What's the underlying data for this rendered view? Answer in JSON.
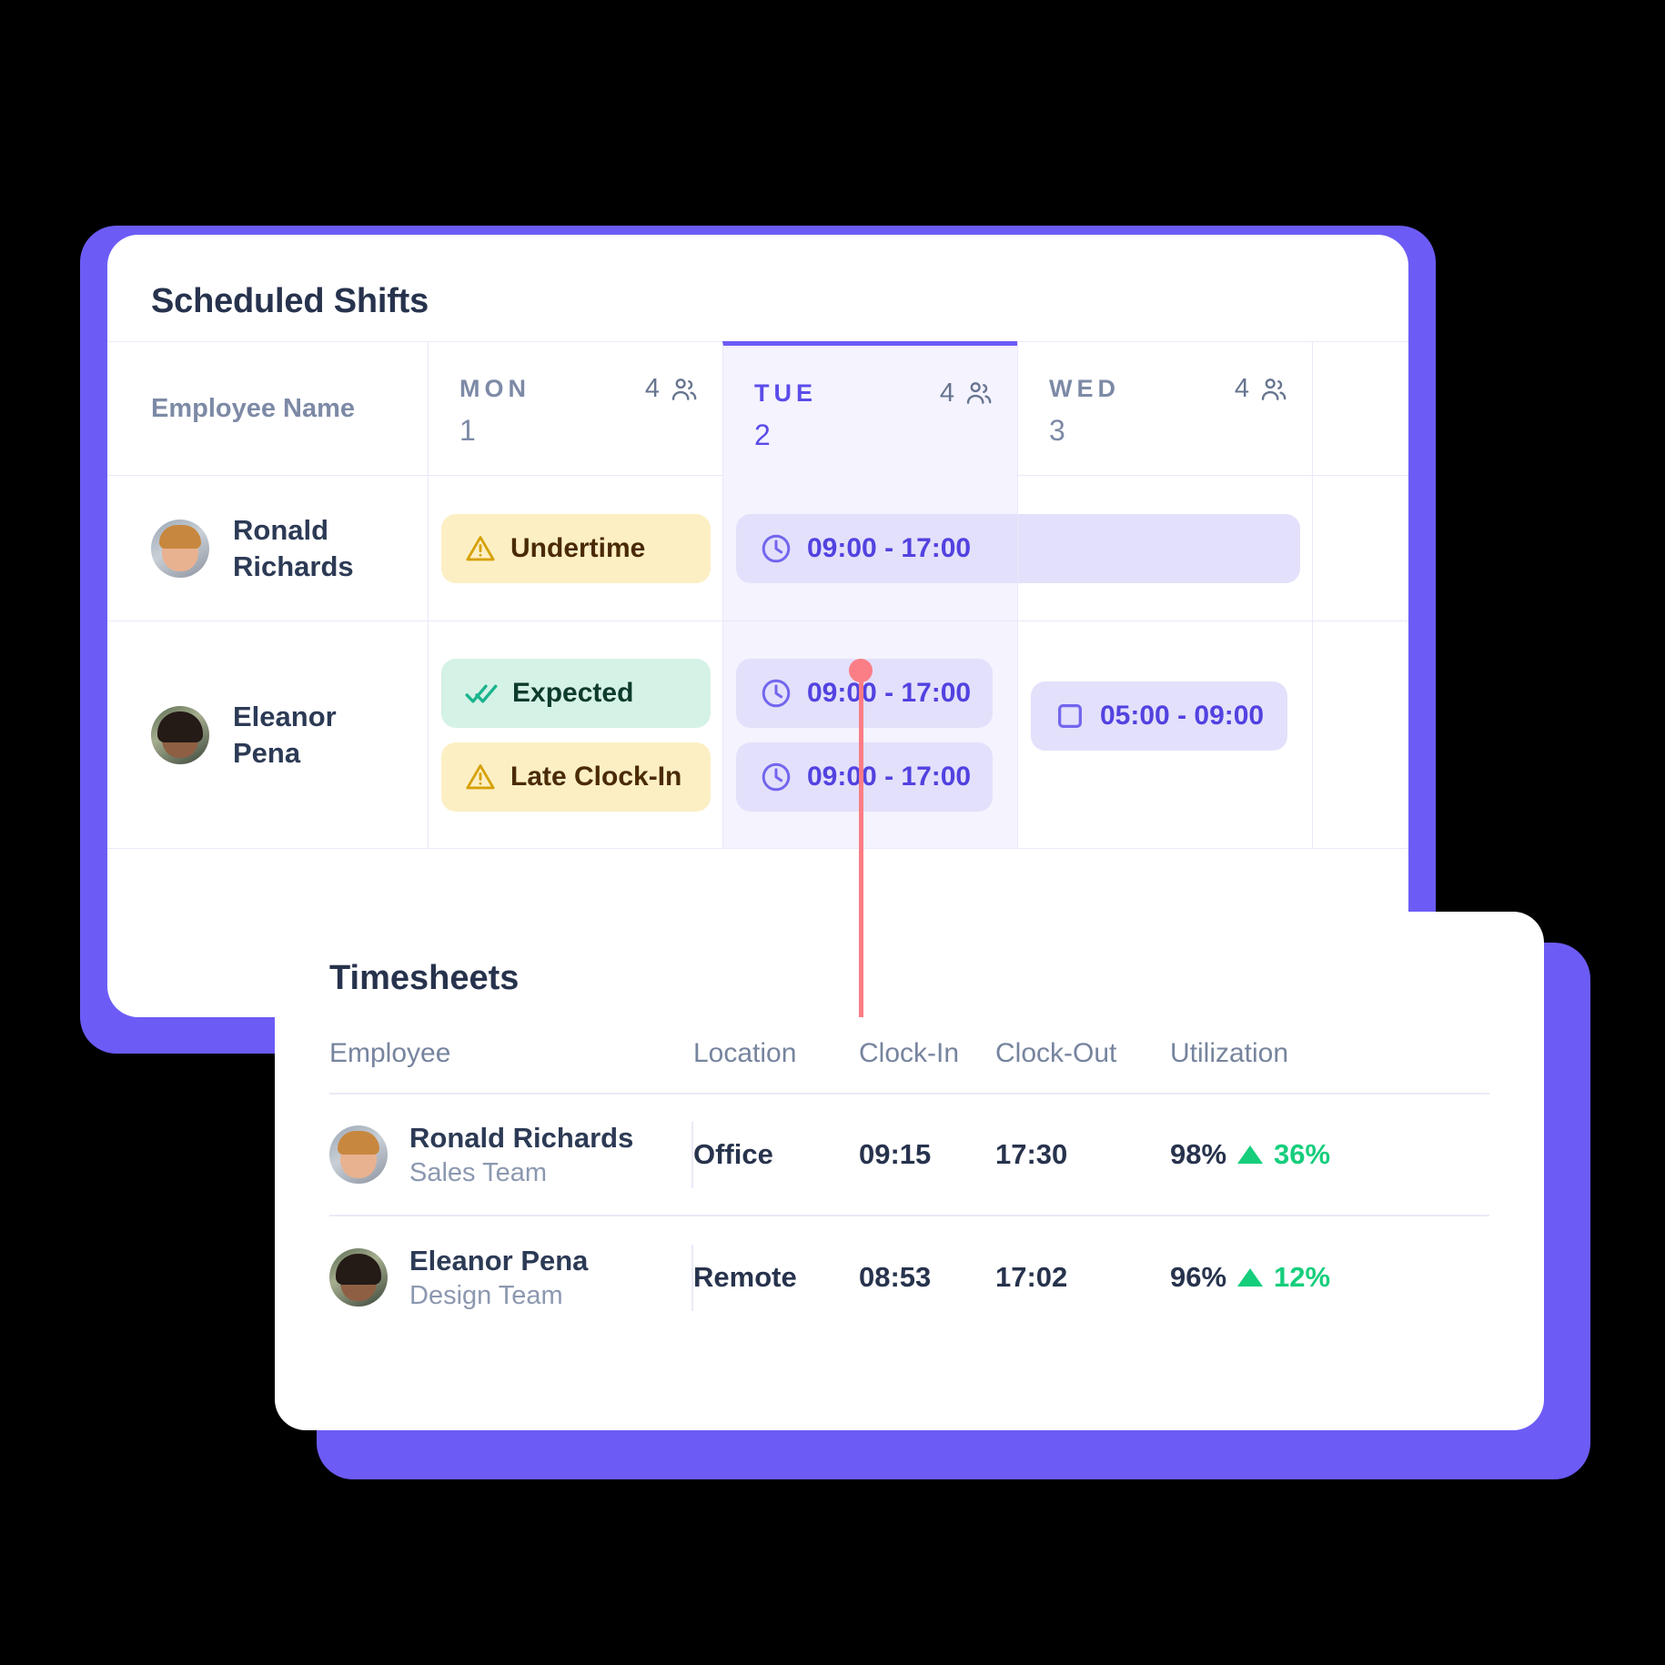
{
  "theme": {
    "accent": "#6C5CF5",
    "bg": "#000000",
    "card": "#ffffff",
    "warn_bg": "#FDEFC4",
    "warn_fg": "#4A2A07",
    "ok_bg": "#D5F2E6",
    "ok_fg": "#0D3B2C",
    "time_bg": "#E3E0FB",
    "time_fg": "#5242E0",
    "now_line": "#FB7D85",
    "positive": "#15CE7C"
  },
  "shifts": {
    "title": "Scheduled Shifts",
    "employee_column_header": "Employee Name",
    "days": [
      {
        "abbr": "MON",
        "num": "1",
        "count": "4",
        "active": false
      },
      {
        "abbr": "TUE",
        "num": "2",
        "count": "4",
        "active": true
      },
      {
        "abbr": "WED",
        "num": "3",
        "count": "4",
        "active": false
      }
    ],
    "rows": [
      {
        "name": "Ronald Richards",
        "name_line1": "Ronald",
        "name_line2": "Richards",
        "avatar": "avatar-ronald",
        "mon": [
          {
            "icon": "warning-icon",
            "label": "Undertime",
            "type": "warn"
          }
        ],
        "tue": [
          {
            "icon": "clock-icon",
            "label": "09:00 - 17:00",
            "type": "time",
            "span": "wide"
          }
        ],
        "wed": []
      },
      {
        "name": "Eleanor Pena",
        "name_line1": "Eleanor",
        "name_line2": "Pena",
        "avatar": "avatar-eleanor",
        "mon": [
          {
            "icon": "double-check-icon",
            "label": "Expected",
            "type": "ok"
          },
          {
            "icon": "warning-icon",
            "label": "Late Clock-In",
            "type": "warn"
          }
        ],
        "tue": [
          {
            "icon": "clock-icon",
            "label": "09:00 - 17:00",
            "type": "time"
          },
          {
            "icon": "clock-icon",
            "label": "09:00 - 17:00",
            "type": "time"
          }
        ],
        "wed": [
          {
            "icon": "square-icon",
            "label": "05:00 - 09:00",
            "type": "time"
          }
        ]
      }
    ]
  },
  "timesheets": {
    "title": "Timesheets",
    "columns": [
      "Employee",
      "Location",
      "Clock-In",
      "Clock-Out",
      "Utilization"
    ],
    "rows": [
      {
        "name": "Ronald Richards",
        "team": "Sales Team",
        "avatar": "avatar-ronald",
        "location": "Office",
        "clock_in": "09:15",
        "clock_out": "17:30",
        "utilization": "98%",
        "delta": "36%",
        "delta_direction": "up"
      },
      {
        "name": "Eleanor Pena",
        "team": "Design Team",
        "avatar": "avatar-eleanor",
        "location": "Remote",
        "clock_in": "08:53",
        "clock_out": "17:02",
        "utilization": "96%",
        "delta": "12%",
        "delta_direction": "up"
      }
    ]
  }
}
